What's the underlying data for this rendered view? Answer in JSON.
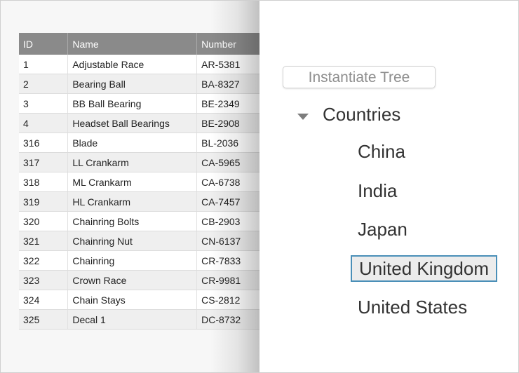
{
  "table": {
    "columns": [
      "ID",
      "Name",
      "Number"
    ],
    "rows": [
      [
        "1",
        "Adjustable Race",
        "AR-5381"
      ],
      [
        "2",
        "Bearing Ball",
        "BA-8327"
      ],
      [
        "3",
        "BB Ball Bearing",
        "BE-2349"
      ],
      [
        "4",
        "Headset Ball Bearings",
        "BE-2908"
      ],
      [
        "316",
        "Blade",
        "BL-2036"
      ],
      [
        "317",
        "LL Crankarm",
        "CA-5965"
      ],
      [
        "318",
        "ML Crankarm",
        "CA-6738"
      ],
      [
        "319",
        "HL Crankarm",
        "CA-7457"
      ],
      [
        "320",
        "Chainring Bolts",
        "CB-2903"
      ],
      [
        "321",
        "Chainring Nut",
        "CN-6137"
      ],
      [
        "322",
        "Chainring",
        "CR-7833"
      ],
      [
        "323",
        "Crown Race",
        "CR-9981"
      ],
      [
        "324",
        "Chain Stays",
        "CS-2812"
      ],
      [
        "325",
        "Decal 1",
        "DC-8732"
      ]
    ]
  },
  "tree": {
    "button_label": "Instantiate Tree",
    "root": {
      "label": "Countries",
      "expanded": true,
      "children": [
        "China",
        "India",
        "Japan",
        "United Kingdom",
        "United States"
      ],
      "selected": "United Kingdom"
    },
    "colors": {
      "selection_border": "#4a8fb8",
      "selection_bg": "#ececec",
      "header_bg": "#8a8a8a"
    }
  }
}
